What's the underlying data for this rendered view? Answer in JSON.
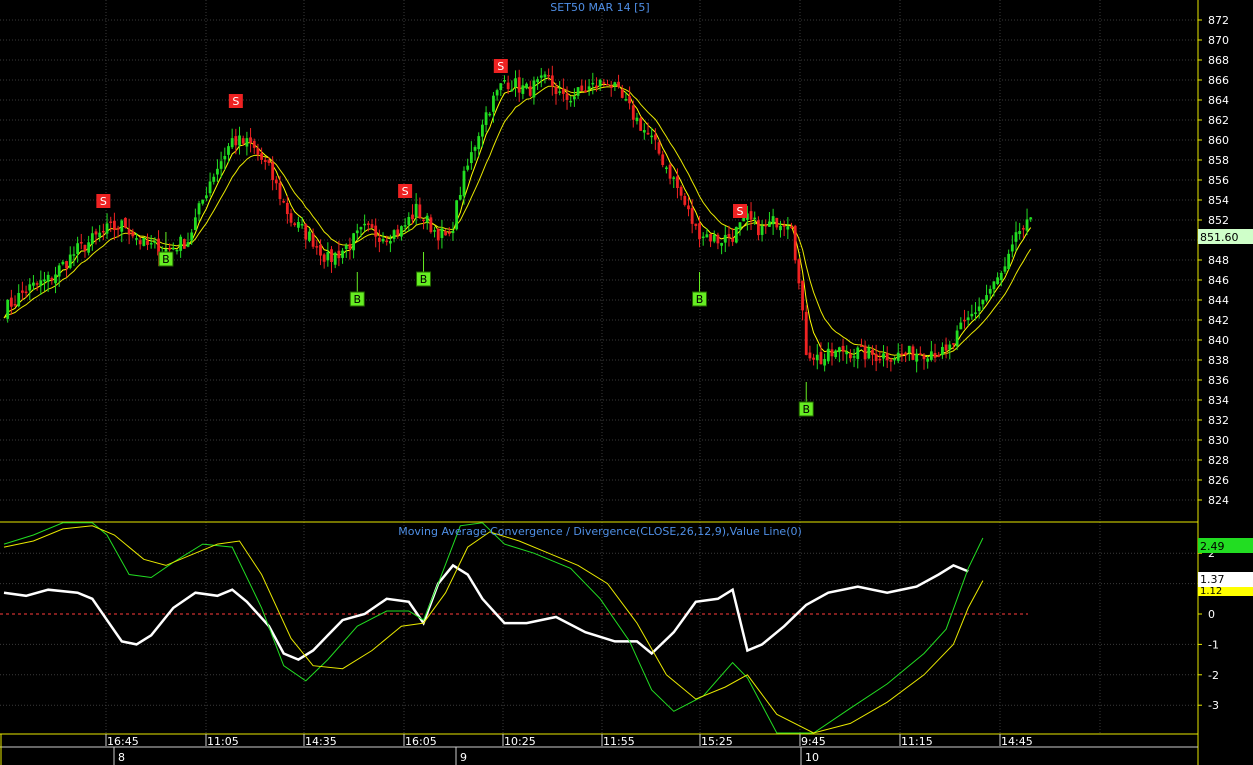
{
  "colors": {
    "background": "#000000",
    "grid": "#3a3a3a",
    "divider": "#e8e800",
    "title": "#4f8fe6",
    "bull": "#22dd22",
    "bear": "#ee2222",
    "ma": "#e8e800",
    "macd_white": "#ffffff",
    "macd_green": "#22dd22",
    "macd_yellow": "#e8e800",
    "zero_line": "#ff3b3b",
    "buy": "#66ee22",
    "sell": "#ee2222"
  },
  "chart_data": [
    {
      "type": "candlestick",
      "title": "SET50 MAR 14   [5]",
      "ylim": [
        823,
        873
      ],
      "y_ticks": [
        824,
        826,
        828,
        830,
        832,
        834,
        836,
        838,
        840,
        842,
        844,
        846,
        848,
        850,
        852,
        854,
        856,
        858,
        860,
        862,
        864,
        866,
        868,
        870,
        872
      ],
      "last_price": "851.60",
      "grid": true,
      "x_time_labels": [
        "16:45",
        "11:05",
        "14:35",
        "16:05",
        "10:25",
        "11:55",
        "15:25",
        "9:45",
        "11:15",
        "14:45"
      ],
      "x_day_labels": [
        "8",
        "9",
        "10"
      ],
      "price_path": [
        [
          0,
          843
        ],
        [
          6,
          845
        ],
        [
          12,
          846
        ],
        [
          20,
          849
        ],
        [
          28,
          851
        ],
        [
          33,
          851.5
        ],
        [
          38,
          849.5
        ],
        [
          44,
          849
        ],
        [
          50,
          850
        ],
        [
          56,
          856
        ],
        [
          62,
          860
        ],
        [
          67,
          859.5
        ],
        [
          72,
          857
        ],
        [
          78,
          852
        ],
        [
          84,
          850
        ],
        [
          88,
          848
        ],
        [
          92,
          849
        ],
        [
          98,
          851
        ],
        [
          103,
          850.5
        ],
        [
          108,
          851
        ],
        [
          112,
          853
        ],
        [
          117,
          851
        ],
        [
          121,
          850
        ],
        [
          124,
          855
        ],
        [
          130,
          862
        ],
        [
          136,
          866
        ],
        [
          142,
          865
        ],
        [
          148,
          866
        ],
        [
          152,
          864
        ],
        [
          158,
          865
        ],
        [
          164,
          866
        ],
        [
          170,
          863
        ],
        [
          176,
          860
        ],
        [
          182,
          856
        ],
        [
          188,
          851
        ],
        [
          194,
          850
        ],
        [
          198,
          850.5
        ],
        [
          202,
          852
        ],
        [
          206,
          851
        ],
        [
          210,
          852
        ],
        [
          214,
          852
        ],
        [
          218,
          839
        ],
        [
          222,
          838
        ],
        [
          228,
          839
        ],
        [
          236,
          838.5
        ],
        [
          244,
          838.5
        ],
        [
          252,
          839
        ],
        [
          256,
          838.5
        ],
        [
          260,
          841
        ],
        [
          264,
          843
        ],
        [
          268,
          845
        ],
        [
          272,
          847
        ],
        [
          276,
          851
        ],
        [
          279,
          851.5
        ]
      ],
      "moving_averages": [
        {
          "color": "#ffff00",
          "period": "fast"
        },
        {
          "color": "#e8e800",
          "period": "slow"
        }
      ],
      "signals": [
        {
          "label": "S",
          "bar": 27,
          "price": 853
        },
        {
          "label": "S",
          "bar": 63,
          "price": 863
        },
        {
          "label": "S",
          "bar": 109,
          "price": 854
        },
        {
          "label": "S",
          "bar": 135,
          "price": 866.5
        },
        {
          "label": "S",
          "bar": 200,
          "price": 852
        },
        {
          "label": "B",
          "bar": 44,
          "price": 849
        },
        {
          "label": "B",
          "bar": 96,
          "price": 845
        },
        {
          "label": "B",
          "bar": 114,
          "price": 847
        },
        {
          "label": "B",
          "bar": 189,
          "price": 845
        },
        {
          "label": "B",
          "bar": 218,
          "price": 834
        }
      ]
    },
    {
      "type": "line",
      "title": "Moving Average Convergence / Divergence(CLOSE,26,12,9),Value Line(0)",
      "ylim": [
        -4,
        3
      ],
      "y_ticks": [
        -3,
        -2,
        -1,
        0,
        1,
        2
      ],
      "value_labels": [
        "2.49",
        "1.37",
        "1.12"
      ],
      "reference_line": 0,
      "series": [
        {
          "color": "#ffffff",
          "values": [
            [
              0,
              0.7
            ],
            [
              6,
              0.6
            ],
            [
              12,
              0.8
            ],
            [
              20,
              0.7
            ],
            [
              24,
              0.5
            ],
            [
              28,
              -0.2
            ],
            [
              32,
              -0.9
            ],
            [
              36,
              -1.0
            ],
            [
              40,
              -0.7
            ],
            [
              46,
              0.2
            ],
            [
              52,
              0.7
            ],
            [
              58,
              0.6
            ],
            [
              62,
              0.8
            ],
            [
              66,
              0.4
            ],
            [
              72,
              -0.4
            ],
            [
              76,
              -1.3
            ],
            [
              80,
              -1.5
            ],
            [
              84,
              -1.2
            ],
            [
              88,
              -0.7
            ],
            [
              92,
              -0.2
            ],
            [
              98,
              0.0
            ],
            [
              104,
              0.5
            ],
            [
              110,
              0.4
            ],
            [
              114,
              -0.3
            ],
            [
              118,
              1.0
            ],
            [
              122,
              1.6
            ],
            [
              126,
              1.3
            ],
            [
              130,
              0.5
            ],
            [
              136,
              -0.3
            ],
            [
              142,
              -0.3
            ],
            [
              150,
              -0.1
            ],
            [
              158,
              -0.6
            ],
            [
              166,
              -0.9
            ],
            [
              172,
              -0.9
            ],
            [
              176,
              -1.3
            ],
            [
              182,
              -0.6
            ],
            [
              188,
              0.4
            ],
            [
              194,
              0.5
            ],
            [
              198,
              0.8
            ],
            [
              202,
              -1.2
            ],
            [
              206,
              -1.0
            ],
            [
              212,
              -0.4
            ],
            [
              218,
              0.3
            ],
            [
              224,
              0.7
            ],
            [
              232,
              0.9
            ],
            [
              240,
              0.7
            ],
            [
              248,
              0.9
            ],
            [
              254,
              1.3
            ],
            [
              258,
              1.6
            ],
            [
              262,
              1.4
            ]
          ]
        },
        {
          "color": "#22dd22",
          "values": [
            [
              0,
              2.3
            ],
            [
              8,
              2.6
            ],
            [
              16,
              3.0
            ],
            [
              24,
              3.0
            ],
            [
              28,
              2.6
            ],
            [
              34,
              1.3
            ],
            [
              40,
              1.2
            ],
            [
              46,
              1.7
            ],
            [
              54,
              2.3
            ],
            [
              62,
              2.2
            ],
            [
              70,
              0.2
            ],
            [
              76,
              -1.7
            ],
            [
              82,
              -2.2
            ],
            [
              88,
              -1.5
            ],
            [
              96,
              -0.4
            ],
            [
              104,
              0.1
            ],
            [
              110,
              0.1
            ],
            [
              114,
              -0.2
            ],
            [
              118,
              1.0
            ],
            [
              124,
              2.9
            ],
            [
              130,
              3.0
            ],
            [
              136,
              2.3
            ],
            [
              144,
              2.0
            ],
            [
              154,
              1.5
            ],
            [
              162,
              0.5
            ],
            [
              170,
              -0.9
            ],
            [
              176,
              -2.5
            ],
            [
              182,
              -3.2
            ],
            [
              190,
              -2.7
            ],
            [
              198,
              -1.6
            ],
            [
              202,
              -2.1
            ],
            [
              210,
              -4.3
            ],
            [
              220,
              -4.5
            ],
            [
              230,
              -3.1
            ],
            [
              240,
              -2.3
            ],
            [
              250,
              -1.3
            ],
            [
              256,
              -0.5
            ],
            [
              262,
              1.5
            ],
            [
              266,
              2.5
            ]
          ]
        },
        {
          "color": "#e8e800",
          "values": [
            [
              0,
              2.2
            ],
            [
              8,
              2.4
            ],
            [
              16,
              2.8
            ],
            [
              24,
              2.9
            ],
            [
              30,
              2.6
            ],
            [
              38,
              1.8
            ],
            [
              44,
              1.6
            ],
            [
              50,
              1.9
            ],
            [
              58,
              2.3
            ],
            [
              64,
              2.4
            ],
            [
              70,
              1.3
            ],
            [
              78,
              -0.8
            ],
            [
              84,
              -1.7
            ],
            [
              92,
              -1.8
            ],
            [
              100,
              -1.2
            ],
            [
              108,
              -0.4
            ],
            [
              114,
              -0.3
            ],
            [
              120,
              0.7
            ],
            [
              126,
              2.2
            ],
            [
              132,
              2.7
            ],
            [
              140,
              2.4
            ],
            [
              148,
              2.0
            ],
            [
              156,
              1.6
            ],
            [
              164,
              1.0
            ],
            [
              172,
              -0.3
            ],
            [
              180,
              -2.0
            ],
            [
              188,
              -2.8
            ],
            [
              196,
              -2.4
            ],
            [
              202,
              -2.0
            ],
            [
              210,
              -3.3
            ],
            [
              220,
              -4.4
            ],
            [
              230,
              -3.6
            ],
            [
              240,
              -2.9
            ],
            [
              250,
              -2.0
            ],
            [
              258,
              -1.0
            ],
            [
              262,
              0.2
            ],
            [
              266,
              1.1
            ]
          ]
        }
      ]
    }
  ]
}
